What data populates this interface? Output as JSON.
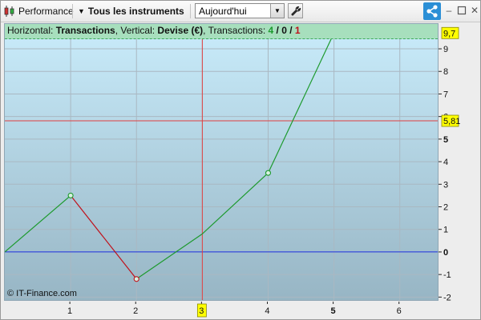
{
  "toolbar": {
    "performance_label": "Performance",
    "instruments_label": "Tous les instruments",
    "period_value": "Aujourd'hui",
    "icons": {
      "performance": "candlestick-icon",
      "instruments": "caret-down-icon",
      "period_dropdown": "chevron-down-icon",
      "settings": "wrench-icon",
      "share": "share-icon",
      "minimize": "minimize-icon",
      "maximize": "maximize-icon",
      "close": "close-icon"
    }
  },
  "info_bar": {
    "h_label": "Horizontal: ",
    "h_value": "Transactions",
    "v_label": ", Vertical: ",
    "v_value": "Devise (€)",
    "t_label": ", Transactions: ",
    "t_won": "4",
    "t_sep1": " / ",
    "t_neutral": "0",
    "t_sep2": " / ",
    "t_lost": "1"
  },
  "copyright": "© IT-Finance.com",
  "colors": {
    "gain": "#1d9a2e",
    "loss": "#c0101a",
    "zero_line": "#1a2fe0",
    "cursor": "#e04040",
    "label_bg": "#ffff00"
  },
  "chart_data": {
    "type": "line",
    "x": [
      0,
      1,
      2,
      3,
      4,
      5
    ],
    "y": [
      0,
      2.5,
      -1.2,
      0.8,
      3.5,
      9.7
    ],
    "markers_at_x": [
      1,
      2,
      4,
      5
    ],
    "xlim": [
      0,
      6.6
    ],
    "ylim": [
      -2.2,
      10.1
    ],
    "x_ticks": [
      "1",
      "2",
      "3",
      "4",
      "5",
      "6"
    ],
    "y_ticks": [
      "-2",
      "-1",
      "0",
      "1",
      "2",
      "3",
      "4",
      "5",
      "6",
      "7",
      "8",
      "9"
    ],
    "y_tick_values": [
      -2,
      -1,
      0,
      1,
      2,
      3,
      4,
      5,
      6,
      7,
      8,
      9
    ],
    "last_value_label": "9,7",
    "last_value": 9.7,
    "cursor_x_label": "3",
    "cursor_x": 3,
    "cursor_y_label": "5,81",
    "cursor_y": 5.81,
    "zero_line": 0,
    "grid": true
  }
}
